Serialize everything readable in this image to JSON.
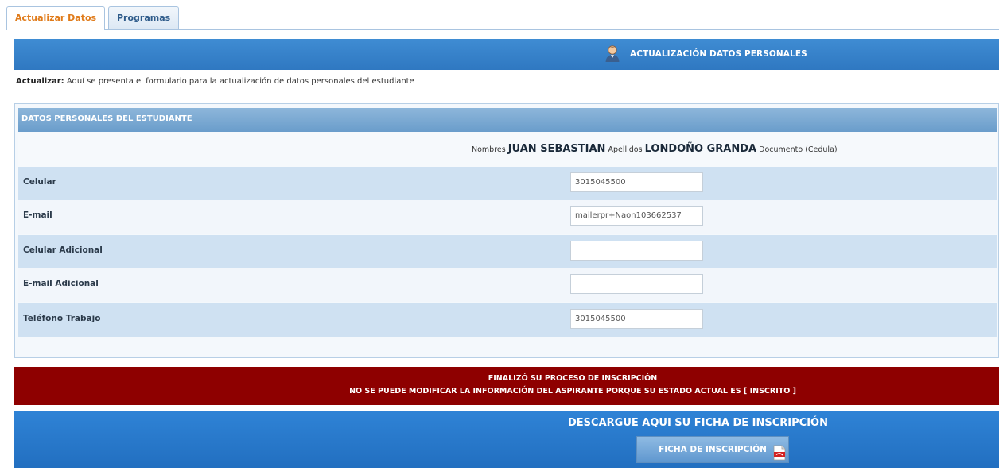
{
  "tabs": [
    {
      "label": "Actualizar Datos",
      "active": true
    },
    {
      "label": "Programas",
      "active": false
    }
  ],
  "header": {
    "title": "ACTUALIZACIÓN DATOS PERSONALES",
    "icon": "user-avatar-icon"
  },
  "intro": {
    "label": "Actualizar:",
    "text": " Aquí se presenta el formulario para la actualización de datos personales del estudiante"
  },
  "panel": {
    "title": "DATOS PERSONALES DEL ESTUDIANTE",
    "names": {
      "nombres_label": "Nombres",
      "nombres_value": "JUAN SEBASTIAN",
      "apellidos_label": "Apellidos",
      "apellidos_value": "LONDOÑO GRANDA",
      "documento_label": "Documento (Cedula)"
    },
    "fields": [
      {
        "label": "Celular",
        "value": "3015045500"
      },
      {
        "label": "E-mail",
        "value": "mailerpr+Naon103662537"
      },
      {
        "label": "Celular Adicional",
        "value": ""
      },
      {
        "label": "E-mail Adicional",
        "value": ""
      },
      {
        "label": "Teléfono Trabajo",
        "value": "3015045500"
      }
    ]
  },
  "alert": {
    "line1": "FINALIZÓ SU PROCESO DE INSCRIPCIÓN",
    "line2": "NO SE PUEDE MODIFICAR LA INFORMACIÓN DEL ASPIRANTE PORQUE SU ESTADO ACTUAL ES [ INSCRITO ]",
    "color": "#8e0000"
  },
  "download": {
    "title": "DESCARGUE AQUI SU FICHA DE INSCRIPCIÓN",
    "button_label": "FICHA DE INSCRIPCIÓN",
    "button_icon": "pdf-icon",
    "color": "#2f83d6"
  }
}
